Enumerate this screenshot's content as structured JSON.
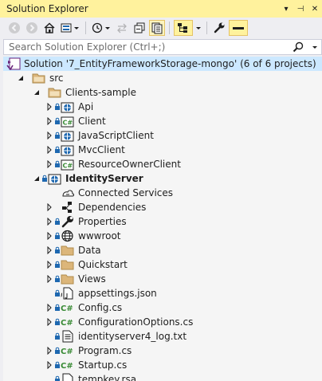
{
  "window": {
    "title": "Solution Explorer",
    "buttons": [
      "▾",
      "⊣",
      "✕"
    ]
  },
  "search": {
    "placeholder": "Search Solution Explorer (Ctrl+;)"
  },
  "colors": {
    "accent_yellow": "#fff29d",
    "selection": "#cce8ff",
    "csharp_green": "#388a34",
    "folder_tan": "#dcb67a",
    "web_blue": "#1e68b0"
  },
  "tree": [
    {
      "label": "Solution '7_EntityFrameworkStorage-mongo' (6 of 6 projects)",
      "icon": "solution-icon",
      "expander": "",
      "lock": false
    },
    {
      "label": "src",
      "icon": "solution-folder-icon",
      "expander": "open",
      "lock": false
    },
    {
      "label": "Clients-sample",
      "icon": "solution-folder-icon",
      "expander": "open",
      "lock": false
    },
    {
      "label": "Api",
      "icon": "web-project-icon",
      "expander": "closed",
      "lock": true
    },
    {
      "label": "Client",
      "icon": "csharp-project-icon",
      "expander": "closed",
      "lock": true
    },
    {
      "label": "JavaScriptClient",
      "icon": "web-project-icon",
      "expander": "closed",
      "lock": true
    },
    {
      "label": "MvcClient",
      "icon": "web-project-icon",
      "expander": "closed",
      "lock": true
    },
    {
      "label": "ResourceOwnerClient",
      "icon": "csharp-project-icon",
      "expander": "closed",
      "lock": true
    },
    {
      "label": "IdentityServer",
      "icon": "web-project-icon",
      "expander": "open",
      "lock": true,
      "bold": true
    },
    {
      "label": "Connected Services",
      "icon": "connected-services-icon",
      "expander": "",
      "lock": false
    },
    {
      "label": "Dependencies",
      "icon": "dependencies-icon",
      "expander": "closed",
      "lock": false
    },
    {
      "label": "Properties",
      "icon": "wrench-icon",
      "expander": "closed",
      "lock": true
    },
    {
      "label": "wwwroot",
      "icon": "globe-icon",
      "expander": "closed",
      "lock": true
    },
    {
      "label": "Data",
      "icon": "folder-icon",
      "expander": "closed",
      "lock": true
    },
    {
      "label": "Quickstart",
      "icon": "folder-icon",
      "expander": "closed",
      "lock": true
    },
    {
      "label": "Views",
      "icon": "folder-icon",
      "expander": "closed",
      "lock": true
    },
    {
      "label": "appsettings.json",
      "icon": "json-file-icon",
      "expander": "",
      "lock": true
    },
    {
      "label": "Config.cs",
      "icon": "csharp-file-icon",
      "expander": "closed",
      "lock": true
    },
    {
      "label": "ConfigurationOptions.cs",
      "icon": "csharp-file-icon",
      "expander": "closed",
      "lock": true
    },
    {
      "label": "identityserver4_log.txt",
      "icon": "text-file-icon",
      "expander": "",
      "lock": true
    },
    {
      "label": "Program.cs",
      "icon": "csharp-file-icon",
      "expander": "closed",
      "lock": true
    },
    {
      "label": "Startup.cs",
      "icon": "csharp-file-icon",
      "expander": "closed",
      "lock": true
    },
    {
      "label": "tempkey.rsa",
      "icon": "file-icon",
      "expander": "",
      "lock": true
    }
  ]
}
